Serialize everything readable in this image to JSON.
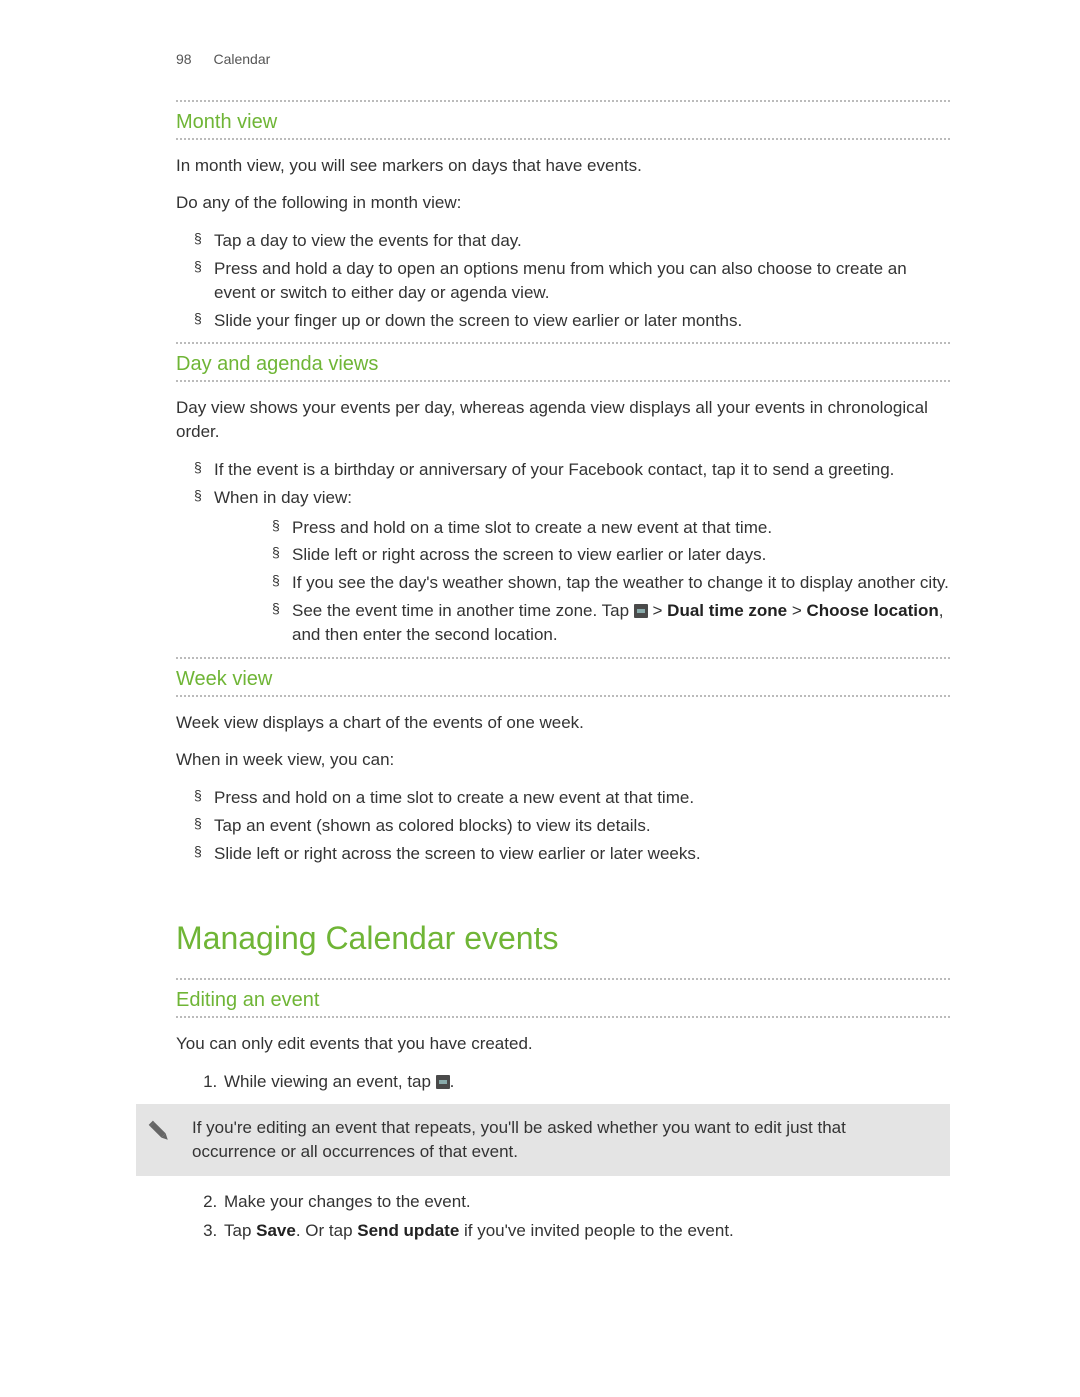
{
  "header": {
    "page_number": "98",
    "section": "Calendar"
  },
  "month_view": {
    "heading": "Month view",
    "intro": "In month view, you will see markers on days that have events.",
    "lead": "Do any of the following in month view:",
    "items": [
      "Tap a day to view the events for that day.",
      "Press and hold a day to open an options menu from which you can also choose to create an event or switch to either day or agenda view.",
      "Slide your finger up or down the screen to view earlier or later months."
    ]
  },
  "day_agenda": {
    "heading": "Day and agenda views",
    "intro": "Day view shows your events per day, whereas agenda view displays all your events in chronological order.",
    "items": [
      "If the event is a birthday or anniversary of your Facebook contact, tap it to send a greeting.",
      "When in day view:"
    ],
    "subitems": [
      "Press and hold on a time slot to create a new event at that time.",
      "Slide left or right across the screen to view earlier or later days.",
      "If you see the day's weather shown, tap the weather to change it to display another city."
    ],
    "tz_prefix": "See the event time in another time zone. Tap ",
    "tz_sep1": " > ",
    "tz_bold1": "Dual time zone",
    "tz_sep2": " > ",
    "tz_bold2": "Choose location",
    "tz_suffix": ", and then enter the second location."
  },
  "week_view": {
    "heading": "Week view",
    "intro1": "Week view displays a chart of the events of one week.",
    "intro2": "When in week view, you can:",
    "items": [
      "Press and hold on a time slot to create a new event at that time.",
      "Tap an event (shown as colored blocks) to view its details.",
      "Slide left or right across the screen to view earlier or later weeks."
    ]
  },
  "managing": {
    "title": "Managing Calendar events",
    "editing_heading": "Editing an event",
    "editing_intro": "You can only edit events that you have created.",
    "step1_prefix": "While viewing an event, tap ",
    "step1_suffix": ".",
    "note": "If you're editing an event that repeats, you'll be asked whether you want to edit just that occurrence or all occurrences of that event.",
    "step2": "Make your changes to the event.",
    "step3_prefix": "Tap ",
    "save_word": "Save",
    "step3_mid": ". Or tap ",
    "send_update_word": "Send update",
    "step3_suffix": " if you've invited people to the event."
  }
}
